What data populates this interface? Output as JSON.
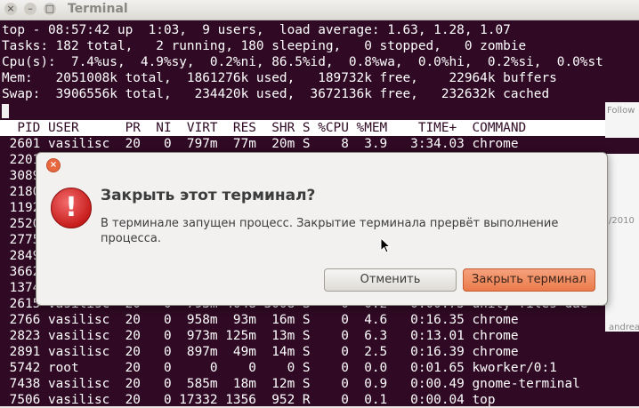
{
  "window": {
    "title": "Terminal",
    "controls": [
      "×",
      "–",
      "□"
    ]
  },
  "top": {
    "summary": [
      "top - 08:57:42 up  1:03,  9 users,  load average: 1.63, 1.28, 1.07",
      "Tasks: 182 total,   2 running, 180 sleeping,   0 stopped,   0 zombie",
      "Cpu(s):  7.4%us,  4.9%sy,  0.2%ni, 86.5%id,  0.8%wa,  0.0%hi,  0.2%si,  0.0%st",
      "Mem:   2051008k total,  1861276k used,   189732k free,    22964k buffers",
      "Swap:  3906556k total,   234420k used,  3672136k free,   232632k cached"
    ],
    "header": "  PID USER      PR  NI  VIRT  RES  SHR S %CPU %MEM    TIME+  COMMAND",
    "rows": [
      " 2601 vasilisc  20   0  797m  77m  20m S    8  3.9   3:34.03 chrome",
      " 2201",
      " 3089",
      " 2180",
      " 1192",
      " 2520",
      " 2775",
      " 2849",
      " 3662",
      " 1374",
      " 2615 vasilisc  20   0  793m 4048 3008 S    0  0.2   0:00.75 unity-files-dae",
      " 2766 vasilisc  20   0  958m  93m  16m S    0  4.6   0:16.35 chrome",
      " 2823 vasilisc  20   0  973m 125m  13m S    0  6.3   0:13.01 chrome",
      " 2891 vasilisc  20   0  897m  49m  14m S    0  2.5   0:16.39 chrome",
      " 5742 root      20   0     0    0    0 S    0  0.0   0:01.65 kworker/0:1",
      " 7438 vasilisc  20   0  585m  18m  12m S    0  0.9   0:00.49 gnome-terminal",
      " 7506 vasilisc  20   0 17332 1356  952 R    0  0.1   0:00.04 top"
    ]
  },
  "peek": {
    "follow": "Follow",
    "date": "/2010",
    "author": "andrea"
  },
  "dialog": {
    "title": "Закрыть этот терминал?",
    "message": "В терминале запущен процесс.  Закрытие терминала прервёт выполнение процесса.",
    "cancel_label": "Отменить",
    "confirm_label": "Закрыть терминал",
    "close_glyph": "×",
    "icon_glyph": "!"
  },
  "colors": {
    "terminal_bg": "#300a24",
    "accent": "#ea7b4c",
    "error": "#c81d1d"
  }
}
